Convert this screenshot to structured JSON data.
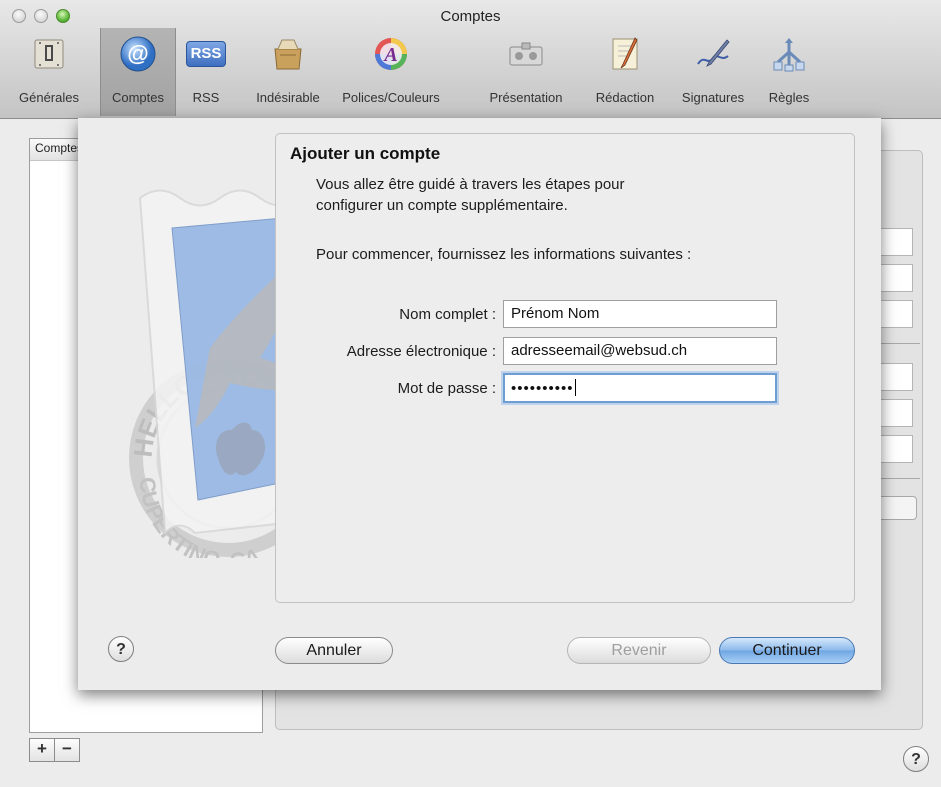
{
  "window": {
    "title": "Comptes"
  },
  "toolbar": [
    {
      "label": "Générales",
      "icon": "general-icon"
    },
    {
      "label": "Comptes",
      "icon": "at-icon",
      "selected": true
    },
    {
      "label": "RSS",
      "icon": "rss-icon",
      "badge": "RSS"
    },
    {
      "label": "Indésirable",
      "icon": "junk-mail-icon"
    },
    {
      "label": "Polices/Couleurs",
      "icon": "fonts-colors-icon",
      "glyph": "A"
    },
    {
      "label": "Présentation",
      "icon": "viewing-icon"
    },
    {
      "label": "Rédaction",
      "icon": "composing-icon"
    },
    {
      "label": "Signatures",
      "icon": "signatures-icon"
    },
    {
      "label": "Règles",
      "icon": "rules-icon"
    }
  ],
  "accounts_panel": {
    "header": "Comptes"
  },
  "stamp": {
    "text_top": "HELLO FROM",
    "text_bottom": "CUPERTINO, CA"
  },
  "dialog": {
    "title": "Ajouter un compte",
    "intro_line1": "Vous allez être guidé à travers les étapes pour",
    "intro_line2": "configurer un compte supplémentaire.",
    "instruction": "Pour commencer, fournissez les informations suivantes :",
    "fields": {
      "full_name": {
        "label": "Nom complet :",
        "value": "Prénom Nom"
      },
      "email": {
        "label": "Adresse électronique :",
        "value": "adresseemail@websud.ch"
      },
      "password": {
        "label": "Mot de passe :",
        "value": "••••••••••"
      }
    },
    "buttons": {
      "cancel": "Annuler",
      "back": "Revenir",
      "continue": "Continuer"
    }
  },
  "footer": {
    "add": "+",
    "remove": "−",
    "help": "?"
  },
  "colors": {
    "focus_ring": "#6f9dd2",
    "default_button": "#7eb2ea",
    "mail_stamp_blue": "#8fb2e2"
  }
}
